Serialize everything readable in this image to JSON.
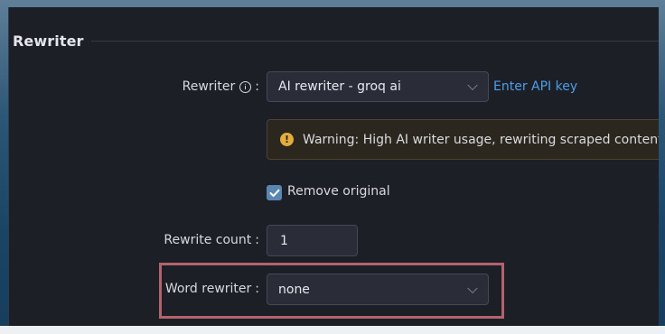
{
  "section": {
    "title": "Rewriter"
  },
  "rewriter": {
    "label": "Rewriter",
    "colon": ":",
    "info_icon": "info-circle-icon",
    "selected": "AI rewriter - groq ai",
    "link": "Enter API key"
  },
  "warning": {
    "icon": "warning-circle-icon",
    "text": "Warning: High AI writer usage, rewriting scraped content"
  },
  "remove_original": {
    "label": "Remove original",
    "checked": true
  },
  "rewrite_count": {
    "label": "Rewrite count",
    "colon": ":",
    "value": "1"
  },
  "word_rewriter": {
    "label": "Word rewriter",
    "colon": ":",
    "selected": "none"
  },
  "colors": {
    "panel_bg": "#1d1f26",
    "link": "#4d9de8",
    "checkbox": "#5a87b2",
    "warning_icon": "#e3ad3e",
    "highlight": "#b4636d"
  }
}
